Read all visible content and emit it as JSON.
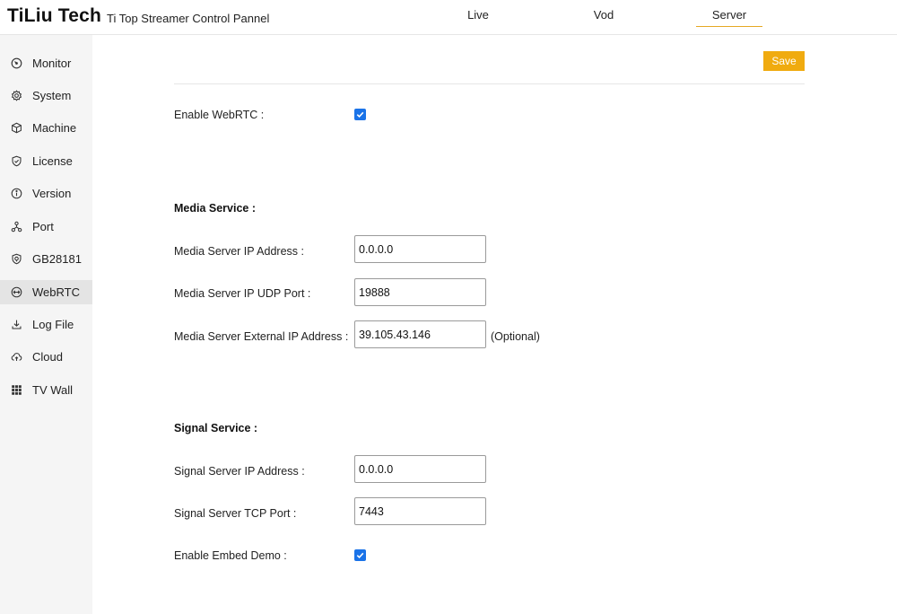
{
  "header": {
    "brand": "TiLiu Tech",
    "subtitle": "Ti Top Streamer Control Pannel",
    "tabs": [
      {
        "label": "Live"
      },
      {
        "label": "Vod"
      },
      {
        "label": "Server",
        "active": true
      }
    ]
  },
  "sidebar": {
    "items": [
      {
        "label": "Monitor",
        "icon": "gauge-icon"
      },
      {
        "label": "System",
        "icon": "gear-icon"
      },
      {
        "label": "Machine",
        "icon": "cube-icon"
      },
      {
        "label": "License",
        "icon": "shield-check-icon"
      },
      {
        "label": "Version",
        "icon": "info-icon"
      },
      {
        "label": "Port",
        "icon": "network-icon"
      },
      {
        "label": "GB28181",
        "icon": "badge-icon"
      },
      {
        "label": "WebRTC",
        "icon": "webrtc-icon",
        "active": true
      },
      {
        "label": "Log File",
        "icon": "download-icon"
      },
      {
        "label": "Cloud",
        "icon": "cloud-upload-icon"
      },
      {
        "label": "TV Wall",
        "icon": "grid-icon"
      }
    ]
  },
  "toolbar": {
    "save_label": "Save"
  },
  "form": {
    "enable_webrtc": {
      "label": "Enable WebRTC :",
      "checked": true
    },
    "media_service": {
      "title": "Media Service :",
      "ip": {
        "label": "Media Server IP Address :",
        "value": "0.0.0.0"
      },
      "udp_port": {
        "label": "Media Server IP UDP Port :",
        "value": "19888"
      },
      "external_ip": {
        "label": "Media Server External IP Address :",
        "value": "39.105.43.146",
        "hint": "(Optional)"
      }
    },
    "signal_service": {
      "title": "Signal Service :",
      "ip": {
        "label": "Signal Server IP Address :",
        "value": "0.0.0.0"
      },
      "tcp_port": {
        "label": "Signal Server TCP Port :",
        "value": "7443"
      }
    },
    "enable_embed_demo": {
      "label": "Enable Embed Demo :",
      "checked": true
    }
  },
  "colors": {
    "accent": "#f0ab10",
    "tab_underline": "#e5a823",
    "checkbox": "#1a73e8",
    "sidebar_bg": "#f5f5f5",
    "sidebar_active": "#e4e4e4"
  }
}
